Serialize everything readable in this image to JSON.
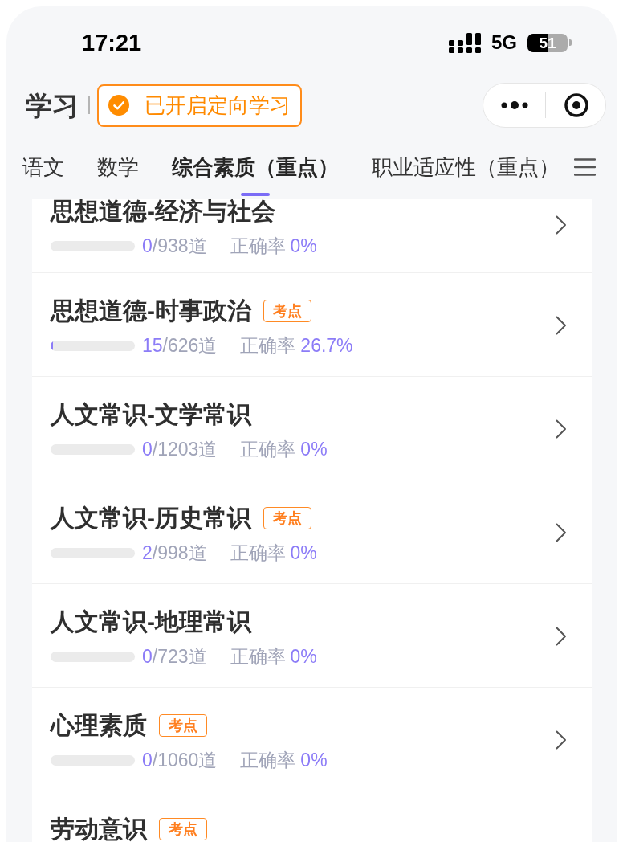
{
  "status_bar": {
    "time": "17:21",
    "network": "5G",
    "battery": "51"
  },
  "header": {
    "title": "学习",
    "mode_button": "已开启定向学习"
  },
  "tabs": [
    {
      "label": "语文",
      "selected": false
    },
    {
      "label": "数学",
      "selected": false
    },
    {
      "label": "综合素质（重点）",
      "selected": true
    },
    {
      "label": "职业适应性（重点）",
      "selected": false
    }
  ],
  "topics": [
    {
      "title": "思想道德-经济与社会",
      "level": 0,
      "answered": "0",
      "total": "/938道",
      "accuracy_label": "正确率",
      "accuracy": "0%"
    },
    {
      "title": "思想道德-时事政治",
      "tag": "考点",
      "level": 0.024,
      "answered": "15",
      "total": "/626道",
      "accuracy_label": "正确率",
      "accuracy": "26.7%"
    },
    {
      "title": "人文常识-文学常识",
      "level": 0,
      "answered": "0",
      "total": "/1203道",
      "accuracy_label": "正确率",
      "accuracy": "0%"
    },
    {
      "title": "人文常识-历史常识",
      "tag": "考点",
      "level": 0.002,
      "answered": "2",
      "total": "/998道",
      "accuracy_label": "正确率",
      "accuracy": "0%"
    },
    {
      "title": "人文常识-地理常识",
      "level": 0,
      "answered": "0",
      "total": "/723道",
      "accuracy_label": "正确率",
      "accuracy": "0%"
    },
    {
      "title": "心理素质",
      "tag": "考点",
      "level": 0,
      "answered": "0",
      "total": "/1060道",
      "accuracy_label": "正确率",
      "accuracy": "0%"
    },
    {
      "title": "劳动意识",
      "tag": "考点"
    }
  ]
}
